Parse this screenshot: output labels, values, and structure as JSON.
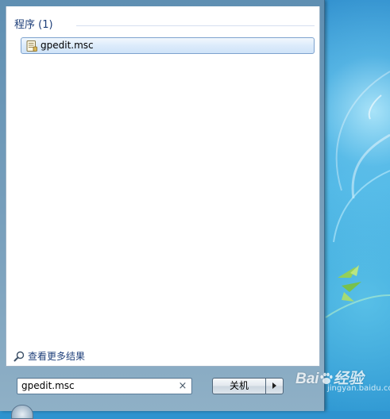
{
  "results": {
    "section_title": "程序 (1)",
    "items": [
      {
        "label": "gpedit.msc",
        "icon": "document-icon"
      }
    ]
  },
  "see_more": {
    "label": "查看更多结果",
    "icon": "search-icon"
  },
  "search": {
    "value": "gpedit.msc",
    "clear_glyph": "×"
  },
  "shutdown": {
    "label": "关机",
    "arrow_icon": "chevron-right-icon"
  },
  "watermark": {
    "brand_left": "Bai",
    "brand_right": "经验",
    "sub": "jingyan.baidu.com"
  },
  "colors": {
    "accent_text": "#1e3f7a",
    "selection_border": "#7da2ce",
    "desktop": "#2f93cf"
  }
}
